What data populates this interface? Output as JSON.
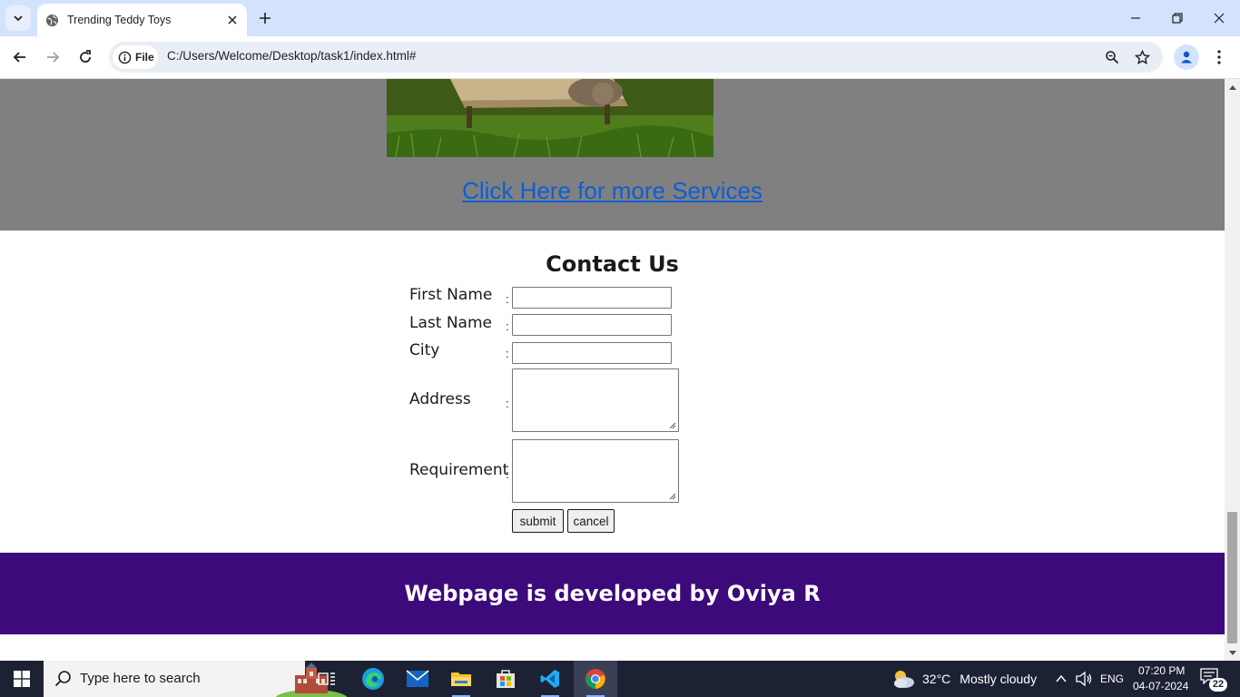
{
  "browser": {
    "tab_title": "Trending Teddy Toys",
    "site_info_label": "File",
    "url": "C:/Users/Welcome/Desktop/task1/index.html#"
  },
  "page": {
    "services_link": "Click Here for more Services",
    "contact_title": "Contact Us",
    "form": {
      "fields": [
        {
          "label": "First Name",
          "colon": ":",
          "value": ""
        },
        {
          "label": "Last Name",
          "colon": ":",
          "value": ""
        },
        {
          "label": "City",
          "colon": ":",
          "value": ""
        },
        {
          "label": "Address",
          "colon": ":",
          "value": ""
        },
        {
          "label": "Requirement",
          "colon": ":",
          "value": ""
        }
      ],
      "submit_label": "submit",
      "cancel_label": "cancel"
    },
    "footer_text": "Webpage is developed by Oviya R"
  },
  "taskbar": {
    "search_placeholder": "Type here to search",
    "weather_temp": "32°C",
    "weather_desc": "Mostly cloudy",
    "language": "ENG",
    "time": "07:20 PM",
    "date": "04-07-2024",
    "notification_count": "22"
  },
  "colors": {
    "tab_strip": "#d3e3fd",
    "grey_section": "#808080",
    "link": "#0b5ed7",
    "footer": "#3c0a7a",
    "taskbar": "#1c2233"
  }
}
